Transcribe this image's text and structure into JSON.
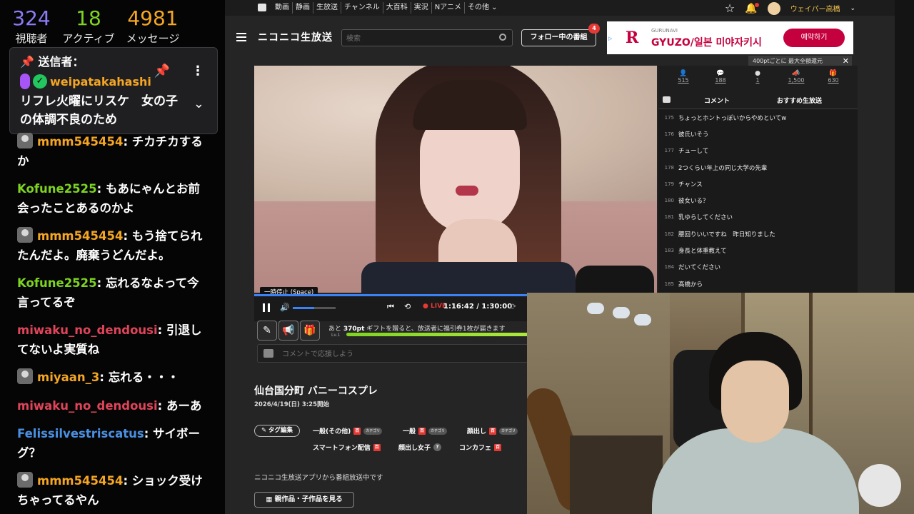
{
  "overlay": {
    "stats": [
      {
        "value": "324",
        "label": "視聴者",
        "color": "#8b7cf6"
      },
      {
        "value": "18",
        "label": "アクティブ",
        "color": "#7ed321"
      },
      {
        "value": "4981",
        "label": "メッセージ",
        "color": "#f5a623"
      }
    ],
    "pinned": {
      "header": "送信者：",
      "user": "weipatakahashi",
      "message": "リフレ火曜にリスケ　女の子の体調不良のため"
    },
    "chat": [
      {
        "name": "mmm545454",
        "text": ": チカチカするか",
        "color": "#f5a623",
        "avatar": true
      },
      {
        "name": "Kofune2525",
        "text": ": もあにゃんとお前会ったことあるのかよ",
        "color": "#7ed321",
        "avatar": false
      },
      {
        "name": "mmm545454",
        "text": ": もう捨てられたんだよ。廃棄うどんだよ。",
        "color": "#f5a623",
        "avatar": true
      },
      {
        "name": "Kofune2525",
        "text": ": 忘れるなよって今言ってるぞ",
        "color": "#7ed321",
        "avatar": false
      },
      {
        "name": "miwaku_no_dendousi",
        "text": ": 引退してないよ実質ね",
        "color": "#e0445a",
        "avatar": false
      },
      {
        "name": "miyaan_3",
        "text": ": 忘れる・・・",
        "color": "#f5a623",
        "avatar": true
      },
      {
        "name": "miwaku_no_dendousi",
        "text": ": あーあ",
        "color": "#e0445a",
        "avatar": false
      },
      {
        "name": "Felissilvestriscatus",
        "text": ": サイボーグ？",
        "color": "#4a90e2",
        "avatar": false
      },
      {
        "name": "mmm545454",
        "text": ": ショック受けちゃってるやん",
        "color": "#f5a623",
        "avatar": true
      }
    ]
  },
  "nico": {
    "topnav": [
      "動画",
      "静画",
      "生放送",
      "チャンネル",
      "大百科",
      "実況",
      "Nアニメ",
      "その他 ⌄"
    ],
    "username": "ウェイパー高橋",
    "logo": "ニコニコ生放送",
    "search_placeholder": "検索",
    "follow_button": "フォロー中の番組",
    "follow_badge": "4",
    "ad": {
      "brand": "GURUNAVI",
      "title": "GYUZO/일본 미야자키시",
      "button": "예약하기"
    },
    "pt_note": "400ptごとに 最大全額還元",
    "player": {
      "tooltip": "一時停止 (Space)",
      "live": "LIVE",
      "time": "1:16:42 / 1:30:00",
      "progress": 0.85,
      "volume": 0.5
    },
    "gift": {
      "text_prefix": "あと ",
      "points": "370pt",
      "text_suffix": " ギフトを贈ると、放送者に福引券1枚が届きます",
      "level": "Lv.1",
      "progress": 0.92
    },
    "comment_placeholder": "コメントで応援しよう",
    "side_stats": [
      {
        "icon": "👤",
        "value": "515"
      },
      {
        "icon": "💬",
        "value": "188"
      },
      {
        "icon": "●",
        "value": "1"
      },
      {
        "icon": "📣",
        "value": "1,500"
      },
      {
        "icon": "🎁",
        "value": "630"
      }
    ],
    "tabs": {
      "comments": "コメント",
      "recommended": "おすすめ生放送"
    },
    "comments": [
      {
        "no": "175",
        "text": "ちょっとホントっぽいからやめといてw"
      },
      {
        "no": "176",
        "text": "彼氏いそう"
      },
      {
        "no": "177",
        "text": "チューして"
      },
      {
        "no": "178",
        "text": "2つくらい年上の同じ大学の先輩"
      },
      {
        "no": "179",
        "text": "チャンス"
      },
      {
        "no": "180",
        "text": "彼女いる？"
      },
      {
        "no": "181",
        "text": "乳ゆらしてください"
      },
      {
        "no": "182",
        "text": "腰回りいいですね　昨日知りました"
      },
      {
        "no": "183",
        "text": "身長と体重教えて"
      },
      {
        "no": "184",
        "text": "だいてください"
      },
      {
        "no": "185",
        "text": "髙橋から"
      }
    ],
    "stream": {
      "title": "仙台国分町 バニーコスプレ",
      "date": "2026/4/19(日) 3:25開始",
      "tag_edit": "タグ編集",
      "tags": [
        "一般(その他)",
        "一般",
        "顔出し",
        "スマートフォン配信",
        "顔出し女子",
        "コンカフェ"
      ],
      "category_badge": "カテゴリ",
      "tag_lock": "百",
      "app_note": "ニコニコ生放送アプリから番組放送中です",
      "related_button": "親作品・子作品を見る"
    }
  }
}
